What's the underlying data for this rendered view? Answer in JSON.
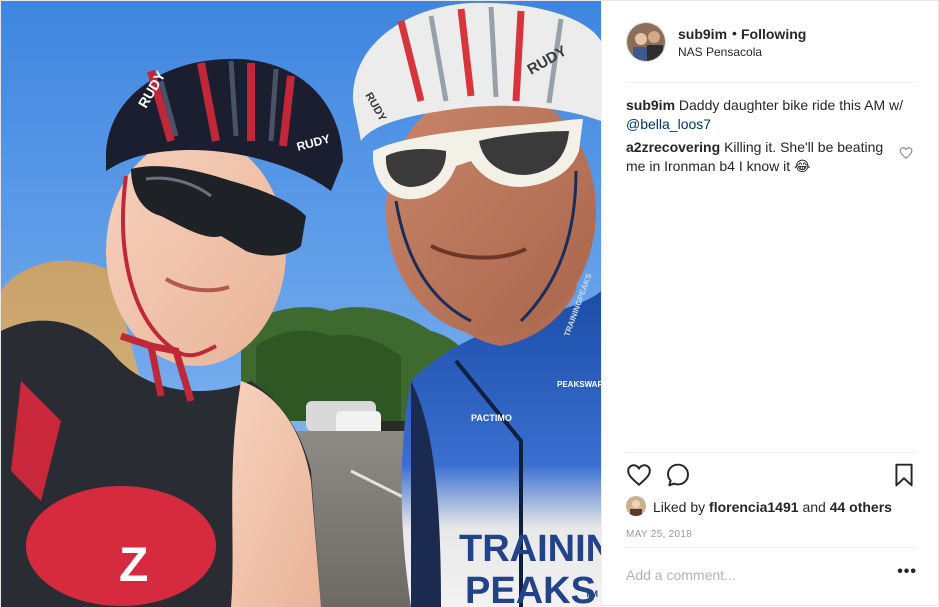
{
  "header": {
    "username": "sub9im",
    "separator": "•",
    "follow_status": "Following",
    "location": "NAS Pensacola"
  },
  "caption": {
    "username": "sub9im",
    "text": "Daddy daughter bike ride this AM w/ ",
    "mention": "@bella_loos7"
  },
  "comments": [
    {
      "username": "a2zrecovering",
      "text": "Killing it. She'll be beating me in Ironman b4 I know it 😂"
    }
  ],
  "likes": {
    "prefix": "Liked by",
    "user": "florencia1491",
    "conjunction": "and",
    "others": "44 others"
  },
  "date": "MAY 25, 2018",
  "add_comment": {
    "placeholder": "Add a comment...",
    "more_label": "•••"
  },
  "photo_text": {
    "helmet_left": "RUDY",
    "helmet_left_2": "RUDY",
    "helmet_right": "RUDY",
    "helmet_right_2": "RUDY",
    "jersey_line1": "TRAININ",
    "jersey_line2": "PEAKS",
    "jersey_tm": "TM",
    "jersey_small": "PACTIMO",
    "jersey_small2": "PEAKSWARE",
    "jersey_small3": "TRAININGPEAKS",
    "top_logo": "Z"
  },
  "colors": {
    "text": "#262626",
    "muted": "#999999",
    "mention": "#003569",
    "border": "#efefef"
  }
}
